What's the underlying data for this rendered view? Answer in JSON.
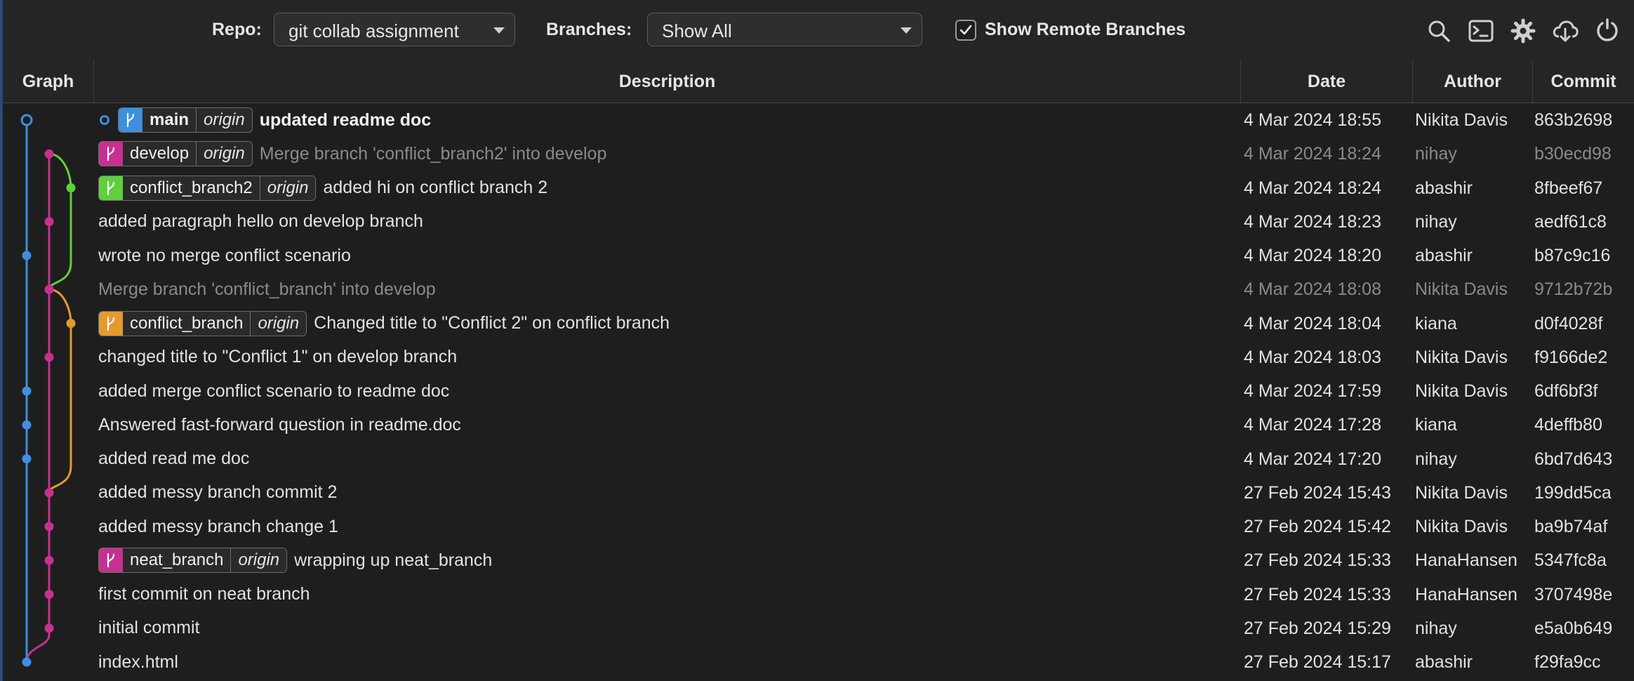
{
  "toolbar": {
    "repo_label": "Repo:",
    "repo_value": "git collab assignment",
    "branches_label": "Branches:",
    "branches_value": "Show All",
    "remote_label": "Show Remote Branches",
    "remote_checked": true,
    "icons": [
      "search-icon",
      "terminal-icon",
      "gear-icon",
      "cloud-download-icon",
      "refresh-icon"
    ]
  },
  "columns": {
    "graph": "Graph",
    "description": "Description",
    "date": "Date",
    "author": "Author",
    "commit": "Commit"
  },
  "colors": {
    "blue": "#3d8fe0",
    "magenta": "#c6318f",
    "green": "#5fcf3c",
    "orange": "#e59a2e",
    "muted_text": "#8a8a8a"
  },
  "commits": [
    {
      "message": "updated readme doc",
      "date": "4 Mar 2024 18:55",
      "author": "Nikita Davis",
      "hash": "863b2698",
      "branch": "main",
      "remote": "origin",
      "lane": "blue",
      "bold": true,
      "head": true
    },
    {
      "message": "Merge branch 'conflict_branch2' into develop",
      "date": "4 Mar 2024 18:24",
      "author": "nihay",
      "hash": "b30ecd98",
      "branch": "develop",
      "remote": "origin",
      "lane": "magenta",
      "muted": true
    },
    {
      "message": "added hi on conflict branch 2",
      "date": "4 Mar 2024 18:24",
      "author": "abashir",
      "hash": "8fbeef67",
      "branch": "conflict_branch2",
      "remote": "origin",
      "lane": "green"
    },
    {
      "message": "added paragraph hello on develop branch",
      "date": "4 Mar 2024 18:23",
      "author": "nihay",
      "hash": "aedf61c8",
      "lane": "magenta"
    },
    {
      "message": "wrote no merge conflict scenario",
      "date": "4 Mar 2024 18:20",
      "author": "abashir",
      "hash": "b87c9c16",
      "lane": "blue"
    },
    {
      "message": "Merge branch 'conflict_branch' into develop",
      "date": "4 Mar 2024 18:08",
      "author": "Nikita Davis",
      "hash": "9712b72b",
      "lane": "magenta",
      "muted": true
    },
    {
      "message": "Changed title to \"Conflict 2\" on conflict branch",
      "date": "4 Mar 2024 18:04",
      "author": "kiana",
      "hash": "d0f4028f",
      "branch": "conflict_branch",
      "remote": "origin",
      "lane": "orange"
    },
    {
      "message": "changed title to \"Conflict 1\" on develop branch",
      "date": "4 Mar 2024 18:03",
      "author": "Nikita Davis",
      "hash": "f9166de2",
      "lane": "magenta"
    },
    {
      "message": "added merge conflict scenario to readme doc",
      "date": "4 Mar 2024 17:59",
      "author": "Nikita Davis",
      "hash": "6df6bf3f",
      "lane": "blue"
    },
    {
      "message": "Answered fast-forward question in readme.doc",
      "date": "4 Mar 2024 17:28",
      "author": "kiana",
      "hash": "4deffb80",
      "lane": "blue"
    },
    {
      "message": "added read me doc",
      "date": "4 Mar 2024 17:20",
      "author": "nihay",
      "hash": "6bd7d643",
      "lane": "blue"
    },
    {
      "message": "added messy branch commit 2",
      "date": "27 Feb 2024 15:43",
      "author": "Nikita Davis",
      "hash": "199dd5ca",
      "lane": "magenta"
    },
    {
      "message": "added messy branch change 1",
      "date": "27 Feb 2024 15:42",
      "author": "Nikita Davis",
      "hash": "ba9b74af",
      "lane": "magenta"
    },
    {
      "message": "wrapping up neat_branch",
      "date": "27 Feb 2024 15:33",
      "author": "HanaHansen",
      "hash": "5347fc8a",
      "branch": "neat_branch",
      "remote": "origin",
      "lane": "magenta"
    },
    {
      "message": "first commit on neat branch",
      "date": "27 Feb 2024 15:33",
      "author": "HanaHansen",
      "hash": "3707498e",
      "lane": "magenta"
    },
    {
      "message": "initial commit",
      "date": "27 Feb 2024 15:29",
      "author": "nihay",
      "hash": "e5a0b649",
      "lane": "magenta"
    },
    {
      "message": "index.html",
      "date": "27 Feb 2024 15:17",
      "author": "abashir",
      "hash": "f29fa9cc",
      "lane": "blue"
    }
  ]
}
